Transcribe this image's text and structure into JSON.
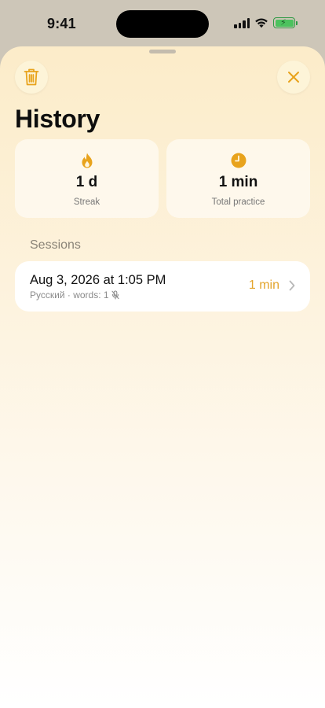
{
  "status_bar": {
    "time": "9:41"
  },
  "header": {
    "title": "History"
  },
  "stats": [
    {
      "value": "1 d",
      "label": "Streak",
      "icon": "flame-icon"
    },
    {
      "value": "1 min",
      "label": "Total practice",
      "icon": "clock-icon"
    }
  ],
  "sessions": {
    "header": "Sessions",
    "items": [
      {
        "title": "Aug 3, 2026 at 1:05 PM",
        "meta": "Русский · words: 1",
        "duration": "1 min"
      }
    ]
  },
  "colors": {
    "accent": "#E8A31C",
    "sheet_top": "#FCECC9",
    "sheet_bottom": "#FFFFFF"
  }
}
